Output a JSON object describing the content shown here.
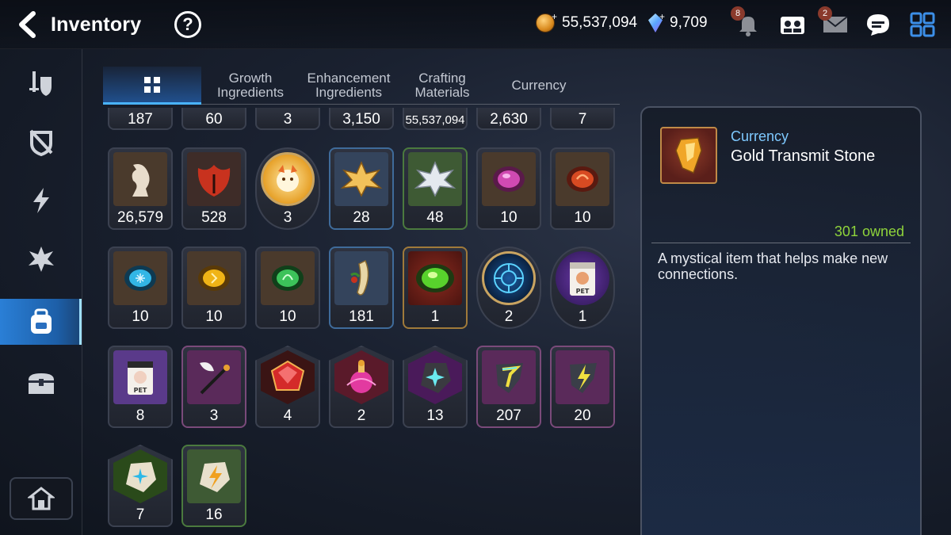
{
  "header": {
    "title": "Inventory",
    "gold": "55,537,094",
    "crystals": "9,709",
    "notifications_badge": "8",
    "mail_badge": "2"
  },
  "sidebar": {
    "items": [
      {
        "icon": "gear-sword-icon"
      },
      {
        "icon": "shield-off-icon"
      },
      {
        "icon": "lightning-icon"
      },
      {
        "icon": "shard-icon"
      },
      {
        "icon": "backpack-icon",
        "active": true
      },
      {
        "icon": "chest-icon"
      }
    ],
    "bottom_icon": "house-icon"
  },
  "tabs": [
    {
      "label": "",
      "icon": "grid-icon",
      "active": true
    },
    {
      "label": "Growth\nIngredients"
    },
    {
      "label": "Enhancement\nIngredients"
    },
    {
      "label": "Crafting\nMaterials"
    },
    {
      "label": "Currency"
    }
  ],
  "grid": {
    "rows": [
      [
        "187",
        "60",
        "3",
        "3,150",
        "55,537,094",
        "2,630",
        "7"
      ],
      [
        "26,579",
        "528",
        "3",
        "28",
        "48",
        "10",
        "10"
      ],
      [
        "10",
        "10",
        "10",
        "181",
        "1",
        "2",
        "1"
      ],
      [
        "8",
        "3",
        "4",
        "2",
        "13",
        "207",
        "20"
      ],
      [
        "7",
        "16"
      ]
    ]
  },
  "detail": {
    "category": "Currency",
    "name": "Gold Transmit Stone",
    "owned": "301 owned",
    "description": "A mystical item that helps make new connections."
  }
}
